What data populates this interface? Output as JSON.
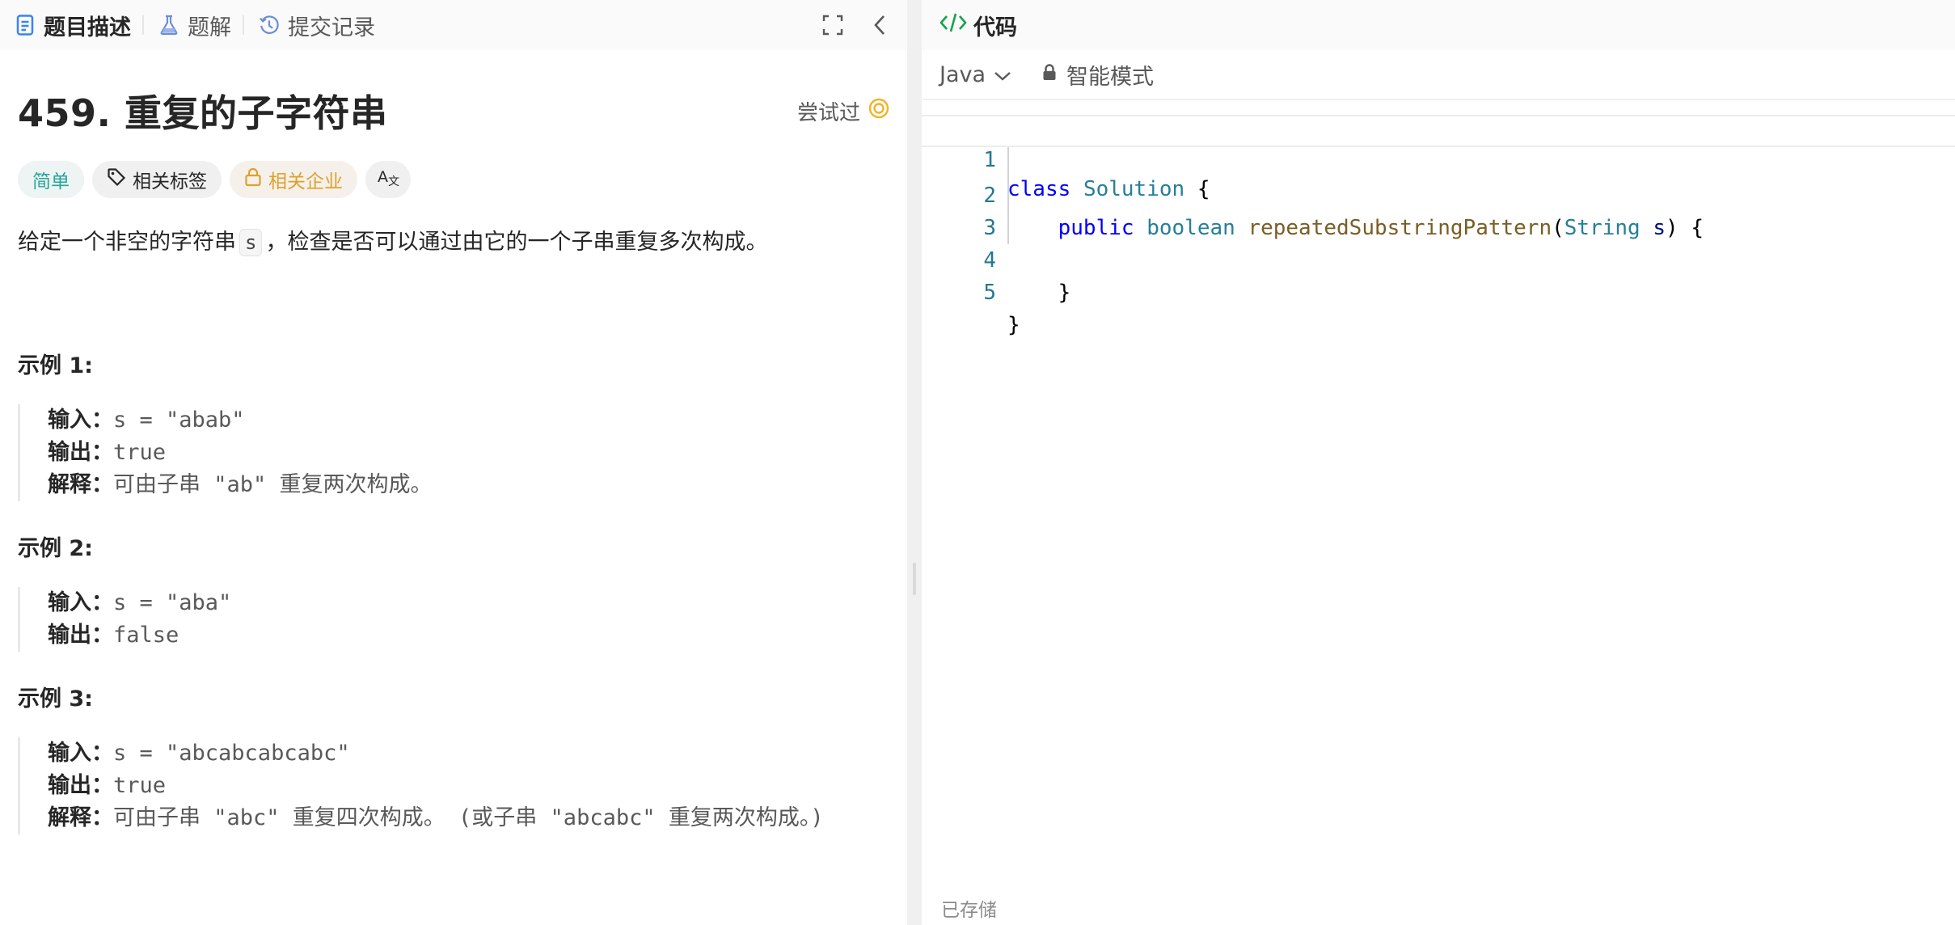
{
  "tabs": [
    {
      "label": "题目描述",
      "icon": "document-icon"
    },
    {
      "label": "题解",
      "icon": "flask-icon"
    },
    {
      "label": "提交记录",
      "icon": "history-icon"
    }
  ],
  "problem": {
    "title": "459. 重复的子字符串",
    "attempted_label": "尝试过",
    "tags": {
      "difficulty": "简单",
      "related_tags": "相关标签",
      "related_companies": "相关企业"
    },
    "description": {
      "prefix": "给定一个非空的字符串",
      "code": "s",
      "suffix": "，检查是否可以通过由它的一个子串重复多次构成。"
    },
    "examples": [
      {
        "heading": "示例 1:",
        "lines": [
          {
            "key": "输入：",
            "value": "s = \"abab\""
          },
          {
            "key": "输出：",
            "value": "true"
          },
          {
            "key": "解释：",
            "value": "可由子串 \"ab\" 重复两次构成。"
          }
        ]
      },
      {
        "heading": "示例 2:",
        "lines": [
          {
            "key": "输入：",
            "value": "s = \"aba\""
          },
          {
            "key": "输出：",
            "value": "false"
          }
        ]
      },
      {
        "heading": "示例 3:",
        "lines": [
          {
            "key": "输入：",
            "value": "s = \"abcabcabcabc\""
          },
          {
            "key": "输出：",
            "value": "true"
          },
          {
            "key": "解释：",
            "value": "可由子串 \"abc\" 重复四次构成。 (或子串 \"abcabc\" 重复两次构成。)"
          }
        ]
      }
    ]
  },
  "code_panel": {
    "title": "代码",
    "language": "Java",
    "mode": "智能模式",
    "saved_status": "已存储",
    "line_numbers": [
      "1",
      "2",
      "3",
      "4",
      "5"
    ]
  },
  "colors": {
    "easy": "#26a69a",
    "company": "#e0a030",
    "keyword": "#0000ff",
    "type": "#267f99",
    "function": "#795e26",
    "line_number": "#237893"
  }
}
